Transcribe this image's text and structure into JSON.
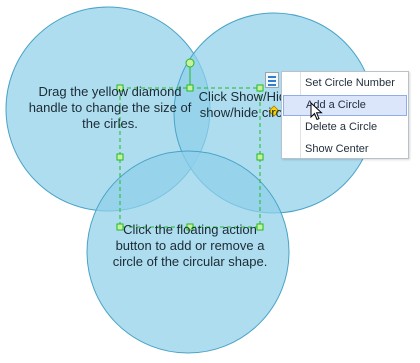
{
  "canvas": {
    "circle_fill": "#8fd0ea",
    "circle_stroke": "#4aa3c6",
    "selection_color": "#22bb22",
    "handle_color": "#ffd200"
  },
  "circles": {
    "left_text": "Drag the yellow diamond handle to change the size of the cirles.",
    "right_text": "Click Show/Hide show/hide circle",
    "bottom_text": "Click the floating action button to add or remove a circle of the circular shape."
  },
  "menu": {
    "items": [
      {
        "label": "Set Circle Number",
        "icon": ""
      },
      {
        "label": "Add a Circle",
        "icon": ""
      },
      {
        "label": "Delete a Circle",
        "icon": ""
      },
      {
        "label": "Show Center",
        "icon": ""
      }
    ],
    "highlighted_index": 1,
    "action_button_icon": "menu-list-icon",
    "highlight_color": "#dbe6fb"
  }
}
